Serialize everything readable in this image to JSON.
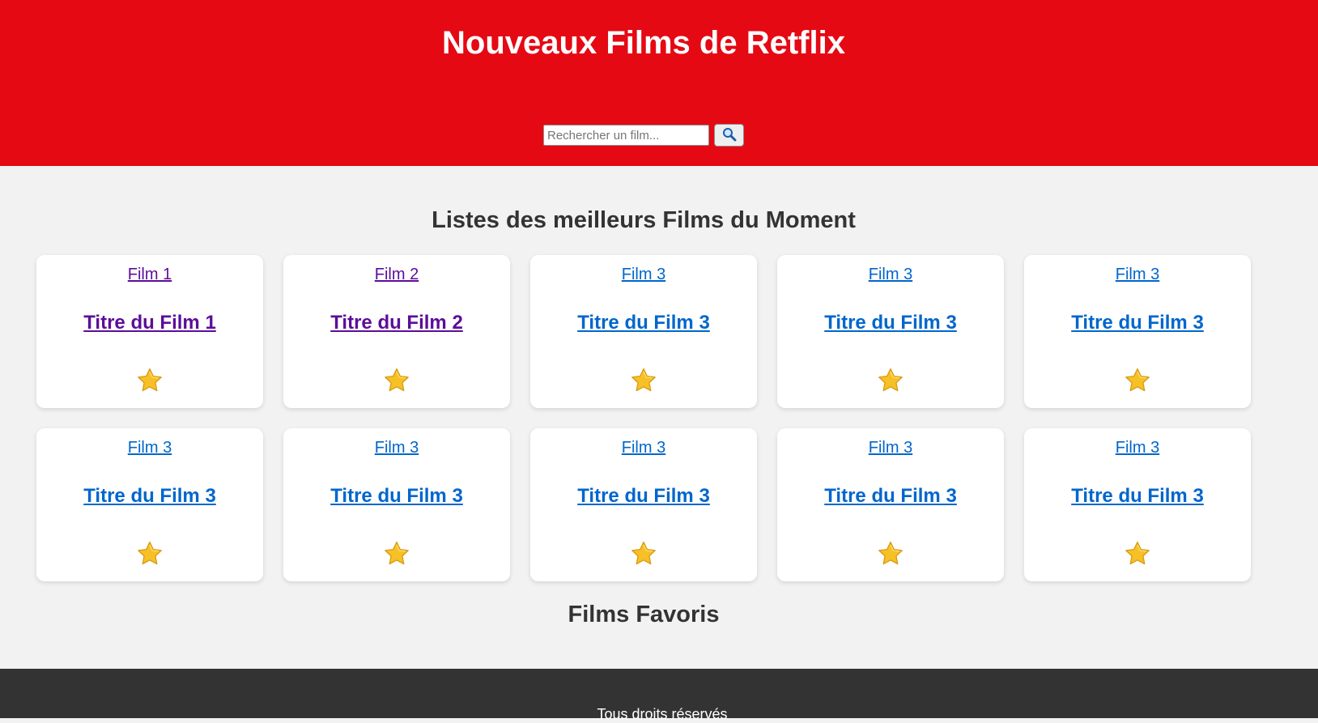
{
  "header": {
    "title": "Nouveaux Films de Retflix",
    "search_placeholder": "Rechercher un film...",
    "search_icon": "magnifier-icon"
  },
  "main": {
    "section_title": "Listes des meilleurs Films du Moment",
    "favorites_title": "Films Favoris",
    "films": [
      {
        "link": "Film 1",
        "title": "Titre du Film 1",
        "visited": true,
        "icon": "star-icon"
      },
      {
        "link": "Film 2",
        "title": "Titre du Film 2",
        "visited": true,
        "icon": "star-icon"
      },
      {
        "link": "Film 3",
        "title": "Titre du Film 3",
        "visited": false,
        "icon": "star-icon"
      },
      {
        "link": "Film 3",
        "title": "Titre du Film 3",
        "visited": false,
        "icon": "star-icon"
      },
      {
        "link": "Film 3",
        "title": "Titre du Film 3",
        "visited": false,
        "icon": "star-icon"
      },
      {
        "link": "Film 3",
        "title": "Titre du Film 3",
        "visited": false,
        "icon": "star-icon"
      },
      {
        "link": "Film 3",
        "title": "Titre du Film 3",
        "visited": false,
        "icon": "star-icon"
      },
      {
        "link": "Film 3",
        "title": "Titre du Film 3",
        "visited": false,
        "icon": "star-icon"
      },
      {
        "link": "Film 3",
        "title": "Titre du Film 3",
        "visited": false,
        "icon": "star-icon"
      },
      {
        "link": "Film 3",
        "title": "Titre du Film 3",
        "visited": false,
        "icon": "star-icon"
      }
    ]
  },
  "footer": {
    "text": "Tous droits réservés"
  },
  "colors": {
    "brand_red": "#e50914",
    "link_blue": "#0066cc",
    "link_visited": "#5c0d99",
    "footer_bg": "#333333",
    "page_bg": "#f2f2f2"
  }
}
